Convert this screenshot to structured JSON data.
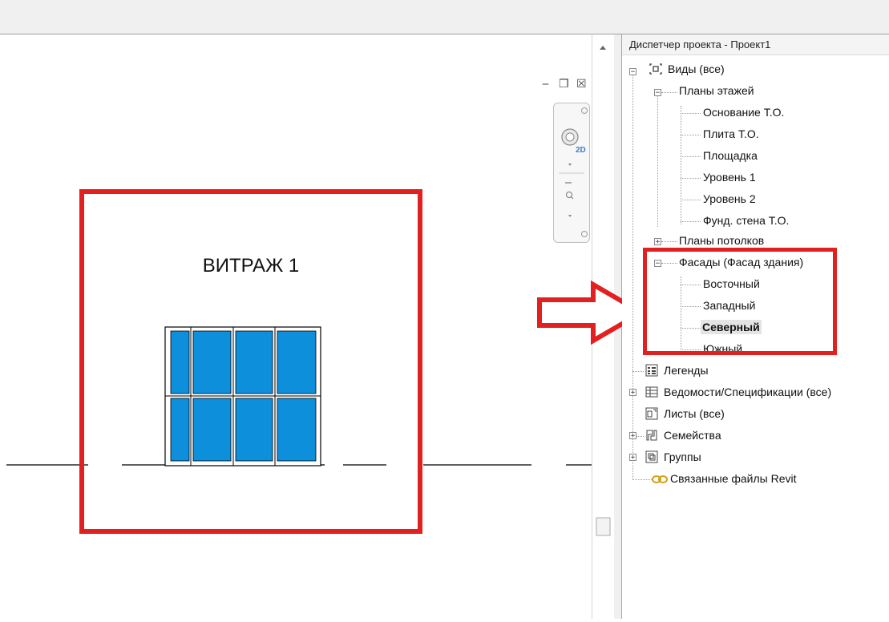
{
  "canvas": {
    "view_title": "ВИТРАЖ 1",
    "glass_color": "#0d8fdc",
    "highlight_color": "#e32020"
  },
  "window_controls": {
    "minimize": "‒",
    "restore": "❐",
    "close": "☒"
  },
  "navbar": {
    "wheel_label": "2D"
  },
  "browser": {
    "title": "Диспетчер проекта - Проект1",
    "root_label": "Виды (все)",
    "floor_plans": {
      "label": "Планы этажей",
      "items": [
        "Основание Т.О.",
        "Плита Т.О.",
        "Площадка",
        "Уровень 1",
        "Уровень 2",
        "Фунд. стена Т.О."
      ]
    },
    "ceiling_plans": {
      "label": "Планы потолков"
    },
    "elevations": {
      "label": "Фасады (Фасад здания)",
      "items": [
        "Восточный",
        "Западный",
        "Северный",
        "Южный"
      ],
      "selected": "Северный"
    },
    "legends": "Легенды",
    "schedules": "Ведомости/Спецификации (все)",
    "sheets": "Листы (все)",
    "families": "Семейства",
    "groups": "Группы",
    "links": "Связанные файлы Revit"
  }
}
